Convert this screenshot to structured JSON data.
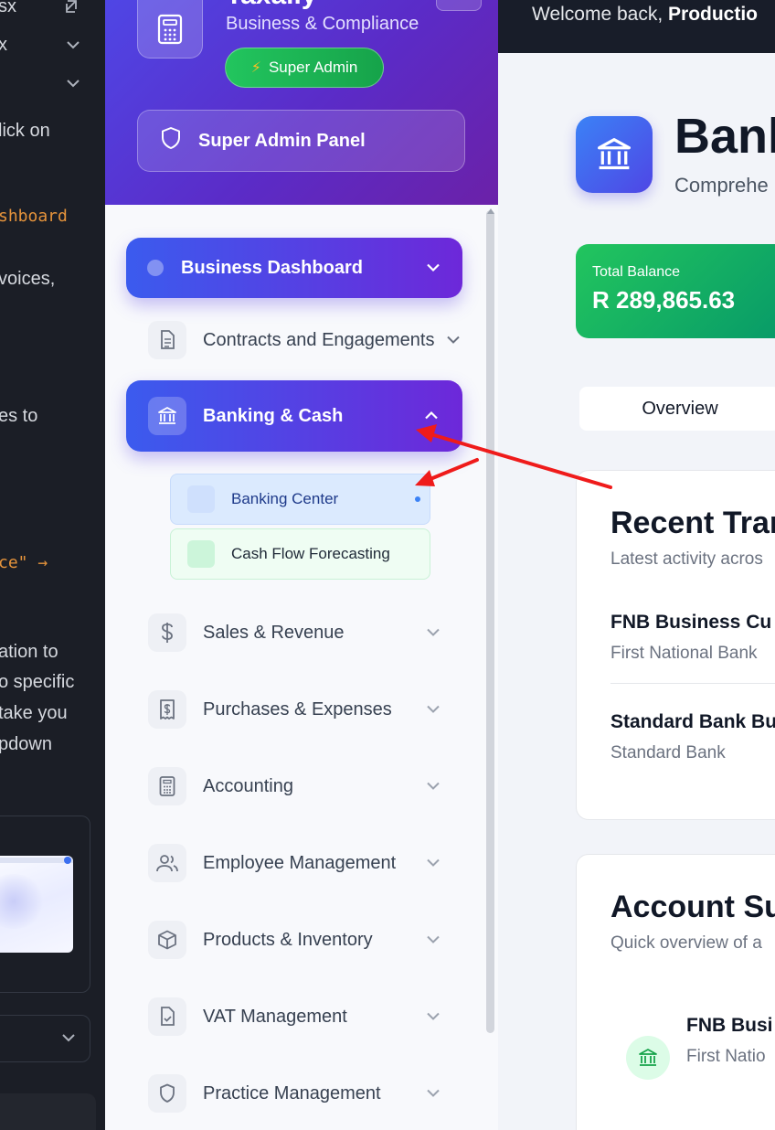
{
  "editor": {
    "lines": [
      "sx",
      "x",
      "",
      "lick on",
      "shboard",
      "voices,",
      "es to",
      "ce\" →",
      "ation to",
      "o specific",
      "take you",
      "pdown"
    ]
  },
  "sidebar": {
    "app_name": "Taxally",
    "app_subtitle": "Business & Compliance",
    "role_badge": "Super Admin",
    "admin_panel": "Super Admin Panel",
    "nav": {
      "business_dashboard": "Business Dashboard",
      "contracts": "Contracts and Engagements",
      "banking": "Banking & Cash",
      "banking_center": "Banking Center",
      "cash_flow": "Cash Flow Forecasting",
      "sales": "Sales & Revenue",
      "purchases": "Purchases & Expenses",
      "accounting": "Accounting",
      "employees": "Employee Management",
      "products": "Products & Inventory",
      "vat": "VAT Management",
      "practice": "Practice Management"
    },
    "colors": {
      "accent_start": "#3b5bee",
      "accent_end": "#6d28d9",
      "badge": "#22c55e"
    }
  },
  "main": {
    "welcome_prefix": "Welcome back,",
    "welcome_user": "Productio",
    "page_title": "Bank",
    "page_subtitle": "Comprehe",
    "balance_label": "Total Balance",
    "balance_value": "R 289,865.63",
    "tab_overview": "Overview",
    "recent": {
      "title": "Recent Tran",
      "subtitle": "Latest activity acros",
      "items": [
        {
          "name": "FNB Business Cu",
          "bank": "First National Bank"
        },
        {
          "name": "Standard Bank Bu",
          "bank": "Standard Bank"
        }
      ]
    },
    "summary": {
      "title": "Account Sur",
      "subtitle": "Quick overview of a",
      "item_name": "FNB Busi",
      "item_bank": "First Natio"
    }
  }
}
